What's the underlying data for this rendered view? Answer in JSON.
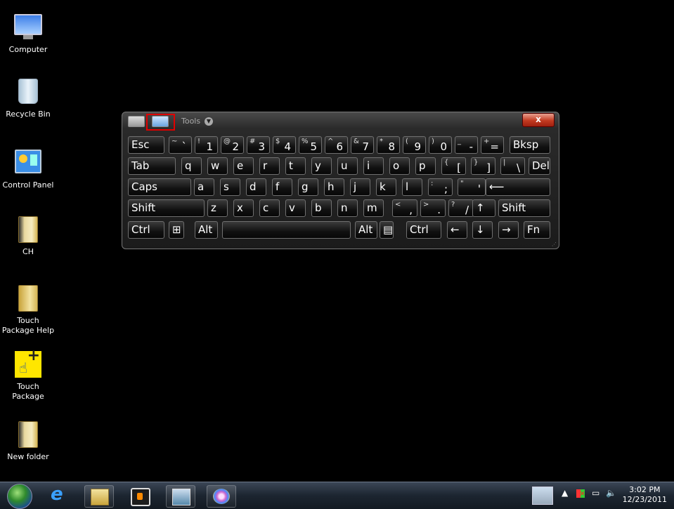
{
  "desktop": {
    "icons": [
      {
        "label": "Computer",
        "icon": "computer-icon"
      },
      {
        "label": "Recycle Bin",
        "icon": "recycle-bin-icon"
      },
      {
        "label": "Control Panel",
        "icon": "control-panel-icon"
      },
      {
        "label": "CH",
        "icon": "folder-icon"
      },
      {
        "label": "Touch\nPackage Help",
        "icon": "folder-icon"
      },
      {
        "label": "Touch\nPackage",
        "icon": "touch-package-icon"
      },
      {
        "label": "New folder",
        "icon": "folder-icon"
      }
    ]
  },
  "osk": {
    "tools_label": "Tools",
    "tools_arrow": "▼",
    "close_label": "x",
    "row1": [
      {
        "main": "Esc"
      },
      {
        "sup": "~",
        "main": "`"
      },
      {
        "sup": "!",
        "main": "1"
      },
      {
        "sup": "@",
        "main": "2"
      },
      {
        "sup": "#",
        "main": "3"
      },
      {
        "sup": "$",
        "main": "4"
      },
      {
        "sup": "%",
        "main": "5"
      },
      {
        "sup": "^",
        "main": "6"
      },
      {
        "sup": "&",
        "main": "7"
      },
      {
        "sup": "*",
        "main": "8"
      },
      {
        "sup": "(",
        "main": "9"
      },
      {
        "sup": ")",
        "main": "0"
      },
      {
        "sup": "_",
        "main": "-"
      },
      {
        "sup": "+",
        "main": "="
      },
      {
        "main": "Bksp"
      }
    ],
    "row2": [
      {
        "main": "Tab"
      },
      {
        "main": "q"
      },
      {
        "main": "w"
      },
      {
        "main": "e"
      },
      {
        "main": "r"
      },
      {
        "main": "t"
      },
      {
        "main": "y"
      },
      {
        "main": "u"
      },
      {
        "main": "i"
      },
      {
        "main": "o"
      },
      {
        "main": "p"
      },
      {
        "sup": "{",
        "main": "["
      },
      {
        "sup": "}",
        "main": "]"
      },
      {
        "sup": "|",
        "main": "\\"
      },
      {
        "main": "Del"
      }
    ],
    "row3": [
      {
        "main": "Caps"
      },
      {
        "main": "a"
      },
      {
        "main": "s"
      },
      {
        "main": "d"
      },
      {
        "main": "f"
      },
      {
        "main": "g"
      },
      {
        "main": "h"
      },
      {
        "main": "j"
      },
      {
        "main": "k"
      },
      {
        "main": "l"
      },
      {
        "sup": ":",
        "main": ";"
      },
      {
        "sup": "\"",
        "main": "'"
      },
      {
        "main": "⟵"
      }
    ],
    "row4": [
      {
        "main": "Shift"
      },
      {
        "main": "z"
      },
      {
        "main": "x"
      },
      {
        "main": "c"
      },
      {
        "main": "v"
      },
      {
        "main": "b"
      },
      {
        "main": "n"
      },
      {
        "main": "m"
      },
      {
        "sup": "<",
        "main": ","
      },
      {
        "sup": ">",
        "main": "."
      },
      {
        "sup": "?",
        "main": "/"
      },
      {
        "main": "↑"
      },
      {
        "main": "Shift"
      }
    ],
    "row5": [
      {
        "main": "Ctrl"
      },
      {
        "main": "⊞"
      },
      {
        "main": "Alt"
      },
      {
        "main": ""
      },
      {
        "main": "Alt"
      },
      {
        "main": "▤"
      },
      {
        "main": "Ctrl"
      },
      {
        "main": "←"
      },
      {
        "main": "↓"
      },
      {
        "main": "→"
      },
      {
        "main": "Fn"
      }
    ]
  },
  "taskbar": {
    "time": "3:02 PM",
    "date": "12/23/2011",
    "tray_arrow": "▲",
    "volume_glyph": "🔈",
    "network_glyph": "▭"
  }
}
